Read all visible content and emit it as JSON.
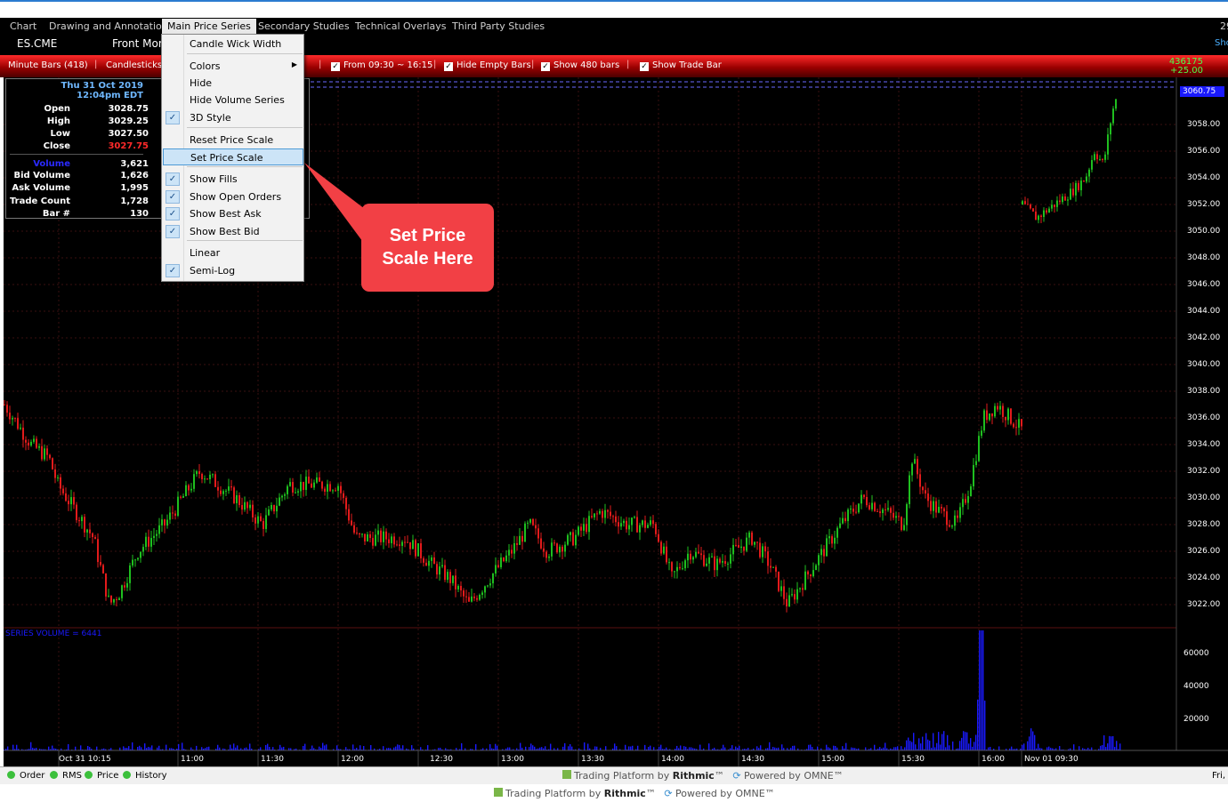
{
  "menubar": {
    "items": [
      "Chart",
      "Drawing and Annotation",
      "Main Price Series",
      "Secondary Studies",
      "Technical Overlays",
      "Third Party Studies"
    ],
    "right_clip": "29",
    "right_clip2": "Sho"
  },
  "symbolbar": {
    "symbol": "ES.CME",
    "contract": "Front Mont"
  },
  "toolbar": {
    "bars": "Minute Bars (418)",
    "style": "Candlesticks",
    "from": "From  09:30 ~ 16:15",
    "hide_empty": "Hide Empty Bars",
    "show_bars": "Show  480 bars",
    "show_trade_bar": "Show Trade Bar",
    "last_qty": "436175",
    "net_change": "+25.00"
  },
  "info": {
    "date": "Thu 31 Oct 2019",
    "time": "12:04pm EDT",
    "rows": [
      {
        "label": "Open",
        "value": "3028.75"
      },
      {
        "label": "High",
        "value": "3029.25"
      },
      {
        "label": "Low",
        "value": "3027.50"
      },
      {
        "label": "Close",
        "value": "3027.75"
      },
      {
        "label": "Volume",
        "value": "3,621"
      },
      {
        "label": "Bid Volume",
        "value": "1,626"
      },
      {
        "label": "Ask Volume",
        "value": "1,995"
      },
      {
        "label": "Trade Count",
        "value": "1,728"
      },
      {
        "label": "Bar #",
        "value": "130"
      }
    ]
  },
  "menu": {
    "items": [
      {
        "label": "Candle Wick Width",
        "checked": false
      },
      {
        "label": "Colors",
        "checked": false,
        "submenu": true
      },
      {
        "label": "Hide",
        "checked": false
      },
      {
        "label": "Hide Volume Series",
        "checked": false
      },
      {
        "label": "3D Style",
        "checked": true
      },
      {
        "label": "Reset Price Scale",
        "checked": false
      },
      {
        "label": "Set Price Scale",
        "checked": false,
        "highlighted": true
      },
      {
        "label": "Show Fills",
        "checked": true
      },
      {
        "label": "Show Open Orders",
        "checked": true
      },
      {
        "label": "Show Best Ask",
        "checked": true
      },
      {
        "label": "Show Best Bid",
        "checked": true
      },
      {
        "label": "Linear",
        "checked": false
      },
      {
        "label": "Semi-Log",
        "checked": true
      }
    ]
  },
  "callout": {
    "line1": "Set Price",
    "line2": "Scale Here"
  },
  "price_axis": {
    "last_price": "3060.75",
    "labels": [
      "3058.00",
      "3056.00",
      "3054.00",
      "3052.00",
      "3050.00",
      "3048.00",
      "3046.00",
      "3044.00",
      "3042.00",
      "3040.00",
      "3038.00",
      "3036.00",
      "3034.00",
      "3032.00",
      "3030.00",
      "3028.00",
      "3026.00",
      "3024.00",
      "3022.00"
    ]
  },
  "volume_axis": {
    "caption": "SERIES VOLUME = 6441",
    "labels": [
      "60000",
      "40000",
      "20000"
    ]
  },
  "time_axis": {
    "labels": [
      "Oct 31 10:15",
      "11:00",
      "11:30",
      "12:00",
      "12:30",
      "13:00",
      "13:30",
      "14:00",
      "14:30",
      "15:00",
      "15:30",
      "16:00",
      "Nov 01 09:30"
    ]
  },
  "status": {
    "items": [
      "Order",
      "RMS",
      "Price",
      "History"
    ],
    "platform_prefix": "Trading Platform by ",
    "platform_brand": "Rithmic",
    "tm": "™",
    "powered_prefix": "Powered by ",
    "powered_brand": "OMNE",
    "right_clip": "Fri,"
  },
  "colors": {
    "up": "#1fbf1f",
    "down": "#e21b1b",
    "volume": "#1a1aff",
    "accent_red": "#ff1a1a",
    "highlight": "#cce4f7"
  },
  "chart_data": {
    "type": "candlestick",
    "price_range": [
      3020.0,
      3061.0
    ],
    "session": "From  09:30 ~ 16:15",
    "last_price": 3060.75
  }
}
